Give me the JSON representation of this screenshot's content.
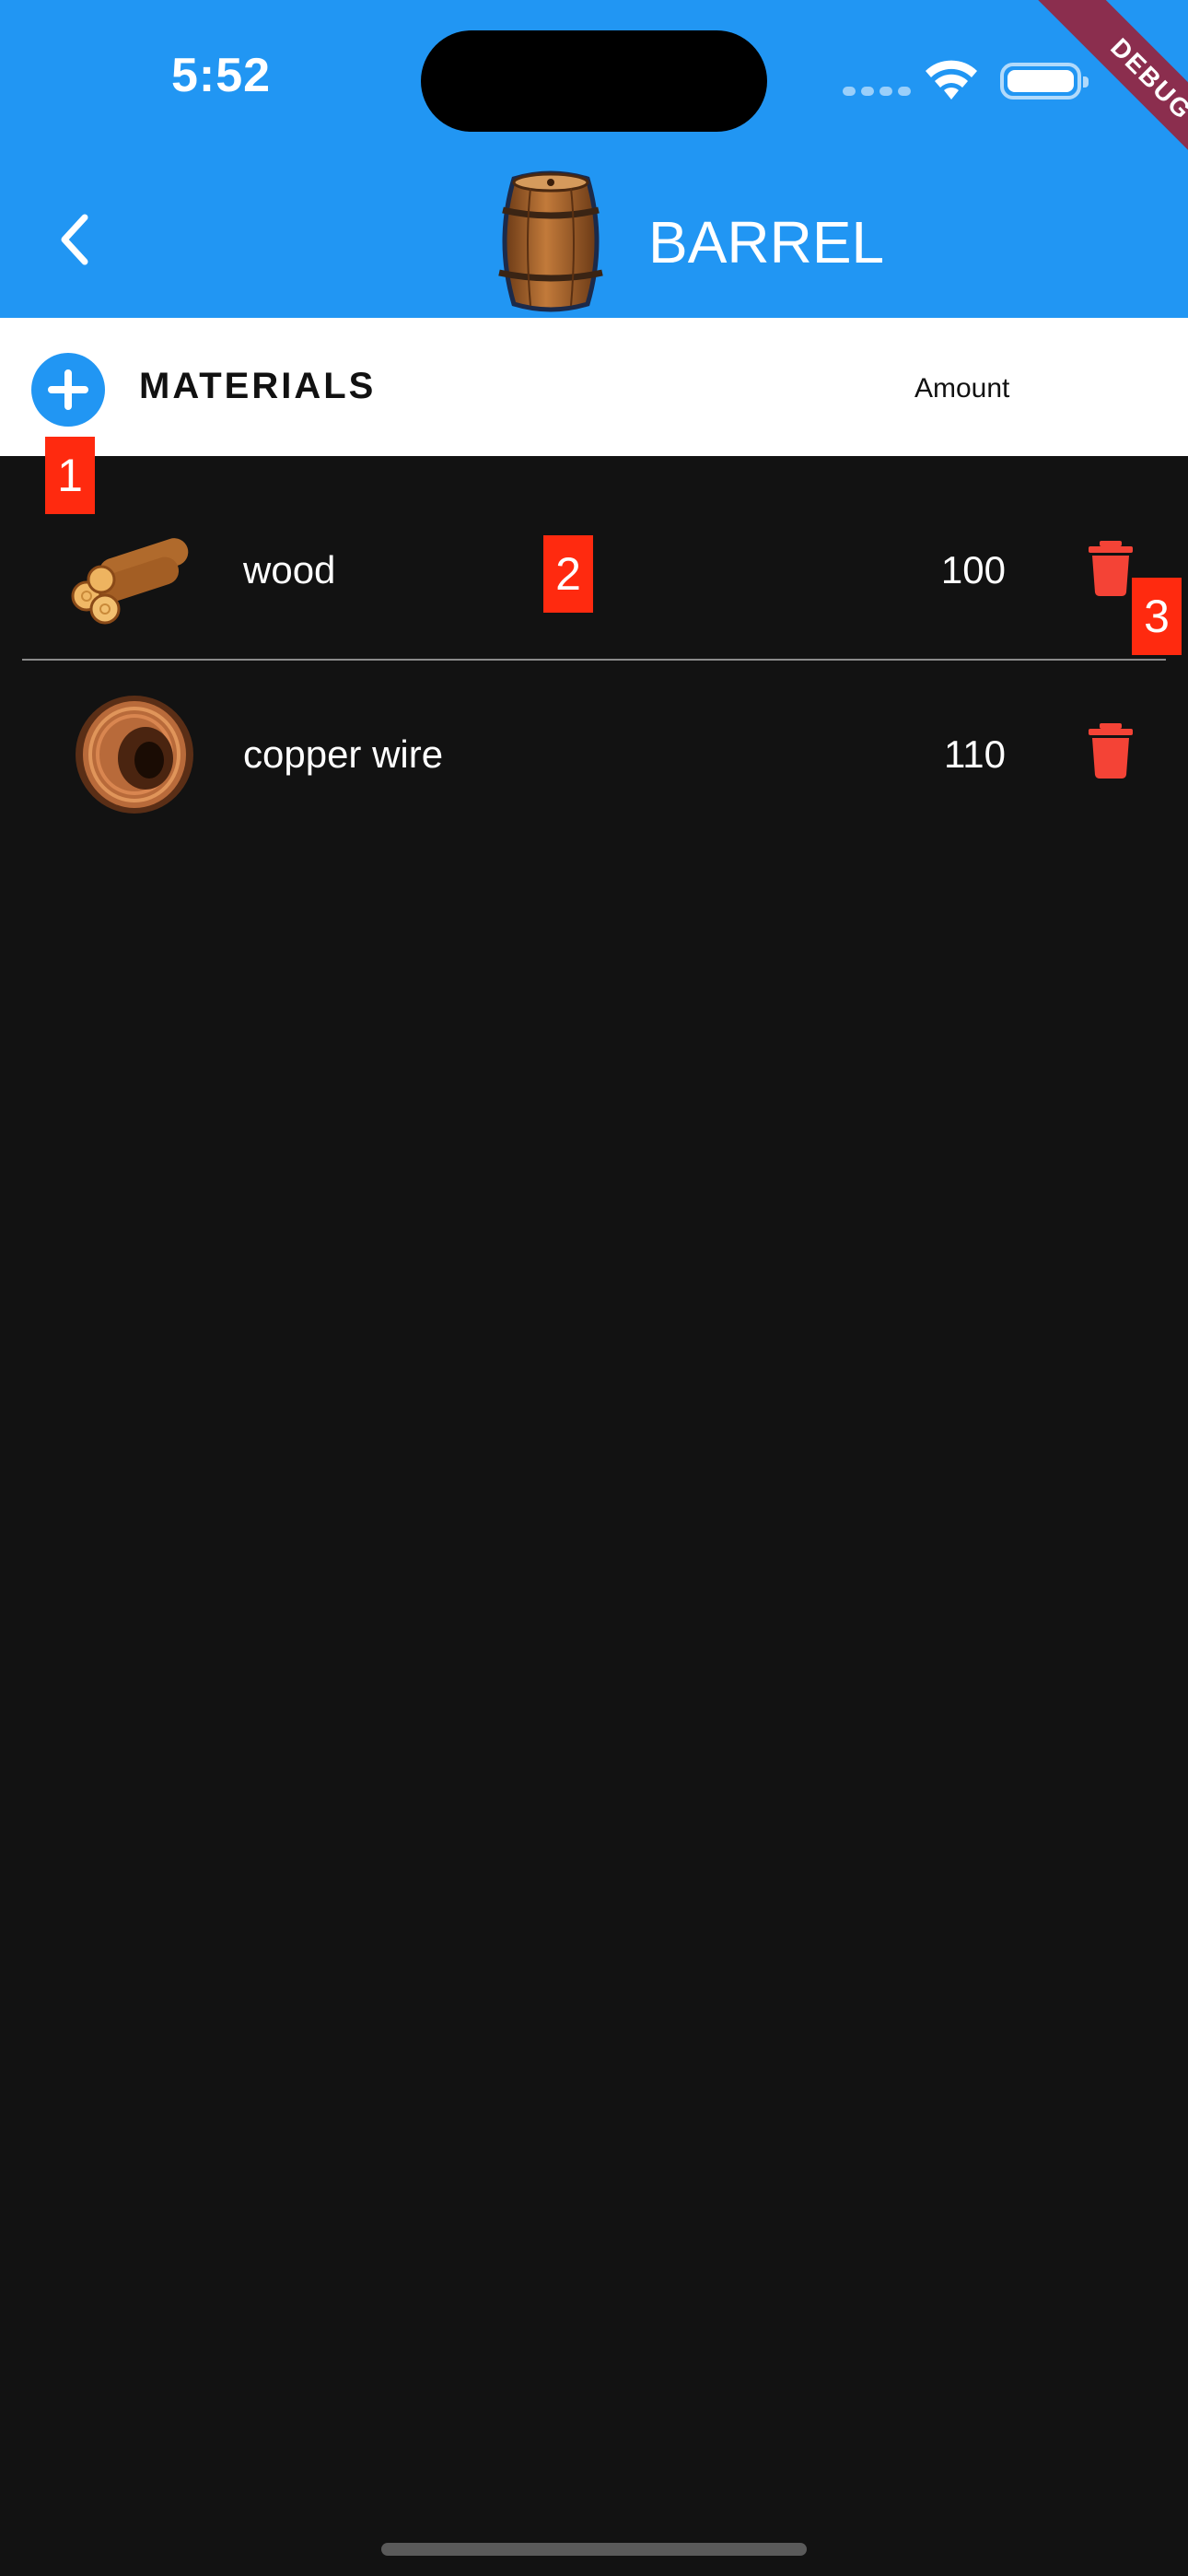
{
  "status_bar": {
    "time": "5:52",
    "debug_label": "DEBUG"
  },
  "app_bar": {
    "back_icon": "chevron-left-icon",
    "title": "BARREL",
    "title_image": "barrel-image"
  },
  "section": {
    "add_icon": "plus-circle-icon",
    "title": "MATERIALS",
    "amount_header": "Amount"
  },
  "materials": [
    {
      "name": "wood",
      "amount": "100",
      "image": "wood-logs-image"
    },
    {
      "name": "copper wire",
      "amount": "110",
      "image": "copper-wire-spool-image"
    }
  ],
  "annotations": [
    "1",
    "2",
    "3"
  ],
  "colors": {
    "primary": "#2196F3",
    "background": "#121212",
    "delete": "#F44336",
    "annotation": "#FF2A0F"
  }
}
